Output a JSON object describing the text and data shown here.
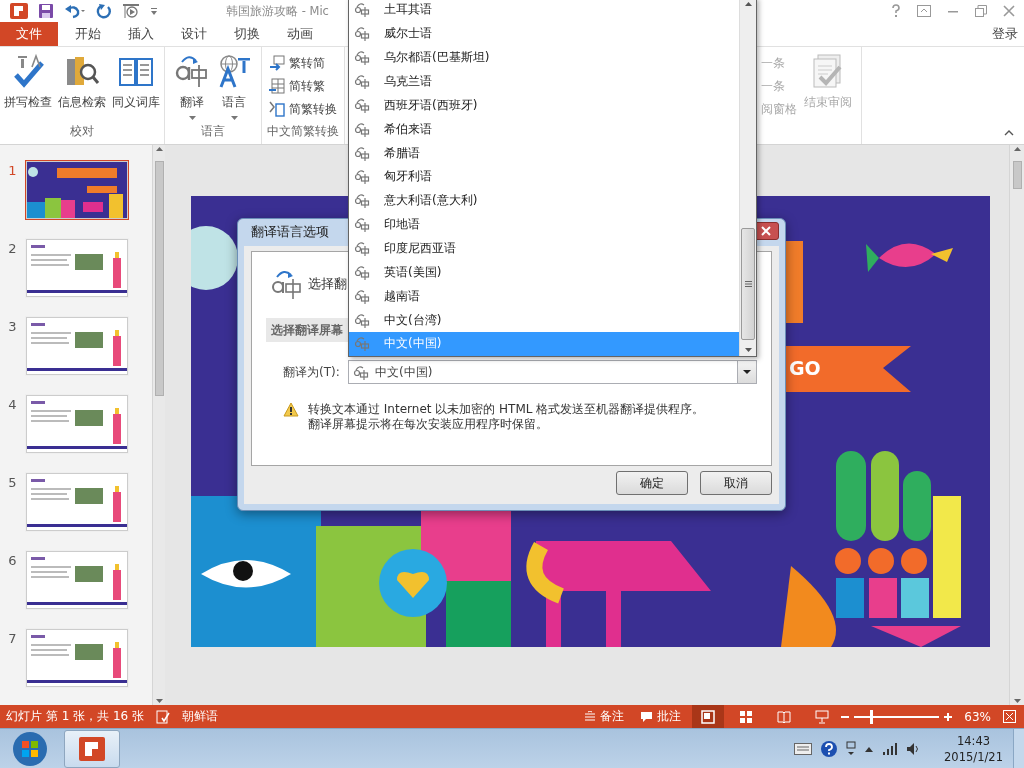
{
  "title_bar": {
    "title": "韩国旅游攻略 - Mic"
  },
  "tabs": [
    {
      "label": "文件",
      "kind": "file"
    },
    {
      "label": "开始",
      "kind": "tab"
    },
    {
      "label": "插入",
      "kind": "tab"
    },
    {
      "label": "设计",
      "kind": "tab"
    },
    {
      "label": "切换",
      "kind": "tab"
    },
    {
      "label": "动画",
      "kind": "tab"
    }
  ],
  "account": {
    "label": "登录"
  },
  "ribbon_groups": [
    {
      "label": "校对",
      "commands": [
        {
          "label": "拼写检查",
          "kind": "large",
          "disabled": false
        },
        {
          "label": "信息检索",
          "kind": "large",
          "disabled": false
        },
        {
          "label": "同义词库",
          "kind": "large",
          "disabled": false
        }
      ]
    },
    {
      "label": "语言",
      "commands": [
        {
          "label": "翻译",
          "kind": "menu",
          "disabled": false
        },
        {
          "label": "语言",
          "kind": "menu",
          "disabled": false
        }
      ]
    },
    {
      "label": "中文简繁转换",
      "commands": [
        {
          "label": "繁转简",
          "kind": "small",
          "disabled": false
        },
        {
          "label": "简转繁",
          "kind": "small",
          "disabled": false
        },
        {
          "label": "简繁转换",
          "kind": "small",
          "disabled": false
        }
      ]
    },
    {
      "commands": [
        {
          "label": "一条",
          "kind": "small",
          "disabled": true
        },
        {
          "label": "一条",
          "kind": "small",
          "disabled": true
        },
        {
          "label": "阅窗格",
          "kind": "small",
          "disabled": true
        },
        {
          "label": "结束审阅",
          "kind": "large",
          "disabled": true
        }
      ]
    }
  ],
  "thumbnails": [
    {
      "number": "1",
      "kind": "title",
      "selected": true
    },
    {
      "number": "2",
      "kind": "content",
      "selected": false
    },
    {
      "number": "3",
      "kind": "content",
      "selected": false
    },
    {
      "number": "4",
      "kind": "content",
      "selected": false
    },
    {
      "number": "5",
      "kind": "content",
      "selected": false
    },
    {
      "number": "6",
      "kind": "content",
      "selected": false
    },
    {
      "number": "7",
      "kind": "content",
      "selected": false
    }
  ],
  "slide": {
    "banner_text": "GO"
  },
  "dialog": {
    "title": "翻译语言选项",
    "heading": "选择翻",
    "section": "选择翻译屏幕",
    "field_label": "翻译为(T):",
    "field_value": "中文(中国)",
    "warning": [
      "转换文本通过 Internet 以未加密的 HTML 格式发送至机器翻译提供程序。",
      "翻译屏幕提示将在每次安装应用程序时保留。"
    ],
    "buttons": [
      "确定",
      "取消"
    ]
  },
  "language_list": {
    "items": [
      {
        "label": "土耳其语",
        "selected": false
      },
      {
        "label": "威尔士语",
        "selected": false
      },
      {
        "label": "乌尔都语(巴基斯坦)",
        "selected": false
      },
      {
        "label": "乌克兰语",
        "selected": false
      },
      {
        "label": "西班牙语(西班牙)",
        "selected": false
      },
      {
        "label": "希伯来语",
        "selected": false
      },
      {
        "label": "希腊语",
        "selected": false
      },
      {
        "label": "匈牙利语",
        "selected": false
      },
      {
        "label": "意大利语(意大利)",
        "selected": false
      },
      {
        "label": "印地语",
        "selected": false
      },
      {
        "label": "印度尼西亚语",
        "selected": false
      },
      {
        "label": "英语(美国)",
        "selected": false
      },
      {
        "label": "越南语",
        "selected": false
      },
      {
        "label": "中文(台湾)",
        "selected": false
      },
      {
        "label": "中文(中国)",
        "selected": true
      }
    ]
  },
  "status_bar": {
    "slide_info": "幻灯片 第 1 张，共 16 张",
    "language": "朝鲜语",
    "notes": "备注",
    "comments": "批注",
    "views": [
      {
        "selected": true
      },
      {
        "selected": false
      },
      {
        "selected": false
      },
      {
        "selected": false
      }
    ],
    "zoom": {
      "level": 0.2
    },
    "zoom_percent": "63%"
  },
  "taskbar": {
    "time": "14:43",
    "date": "2015/1/21"
  }
}
